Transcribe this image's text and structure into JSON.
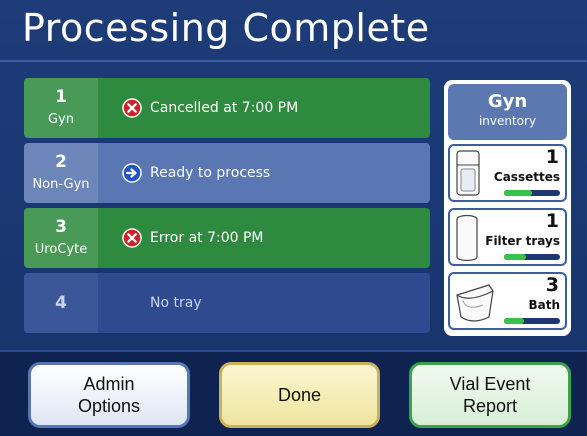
{
  "title": "Processing Complete",
  "bays": [
    {
      "number": "1",
      "type": "Gyn",
      "status": "Cancelled at 7:00 PM",
      "icon": "cancel-icon",
      "color": "#2e8a3e"
    },
    {
      "number": "2",
      "type": "Non-Gyn",
      "status": "Ready to process",
      "icon": "arrow-right-icon",
      "color": "#5a77b3"
    },
    {
      "number": "3",
      "type": "UroCyte",
      "status": "Error at 7:00 PM",
      "icon": "error-icon",
      "color": "#2e8a3e"
    },
    {
      "number": "4",
      "type": "",
      "status": "No tray",
      "icon": "",
      "color": "#2f4b8f"
    }
  ],
  "inventory": {
    "title": "Gyn",
    "subtitle": "inventory",
    "items": [
      {
        "label": "Cassettes",
        "count": "1",
        "icon": "cassette-icon",
        "level": 0.5
      },
      {
        "label": "Filter trays",
        "count": "1",
        "icon": "filter-tray-icon",
        "level": 0.4
      },
      {
        "label": "Bath",
        "count": "3",
        "icon": "bath-icon",
        "level": 0.35
      }
    ]
  },
  "buttons": {
    "admin_line1": "Admin",
    "admin_line2": "Options",
    "done": "Done",
    "vial_line1": "Vial Event",
    "vial_line2": "Report"
  },
  "colors": {
    "background": "#19356e",
    "bay_green": "#2e8a3e",
    "bay_blue": "#5a77b3",
    "accent_green": "#38c34a",
    "error_red": "#d0202a"
  }
}
